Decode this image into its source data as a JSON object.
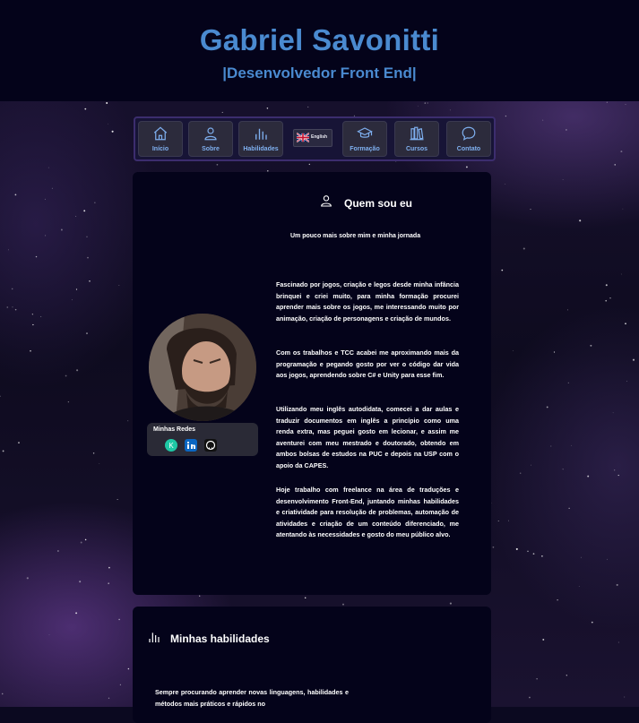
{
  "header": {
    "name": "Gabriel Savonitti",
    "subtitle": "|Desenvolvedor Front End|"
  },
  "nav": {
    "items": [
      {
        "label": "Início",
        "icon": "home-icon"
      },
      {
        "label": "Sobre",
        "icon": "user-icon"
      },
      {
        "label": "Habilidades",
        "icon": "bar-chart-icon"
      },
      {
        "label": "Formação",
        "icon": "graduation-cap-icon"
      },
      {
        "label": "Cursos",
        "icon": "books-icon"
      },
      {
        "label": "Contato",
        "icon": "chat-bubble-icon"
      }
    ],
    "language": {
      "label": "English",
      "icon": "uk-flag-icon"
    }
  },
  "about": {
    "title": "Quem sou eu",
    "subtitle": "Um pouco mais sobre mim e minha jornada",
    "paragraphs": [
      "Fascinado por jogos, criação e legos desde minha infância brinquei e criei muito, para minha formação procurei aprender mais sobre os jogos, me interessando muito por animação, criação de personagens e criação de mundos.",
      "Com os trabalhos e TCC acabei me aproximando mais da programação e pegando gosto por ver o código dar vida aos jogos, aprendendo sobre C# e Unity para esse fim.",
      "Utilizando meu inglês autodidata, comecei a dar aulas e traduzir documentos em inglês a princípio como uma renda extra, mas peguei gosto em lecionar, e assim me aventurei com meu mestrado e doutorado, obtendo em ambos bolsas de estudos na PUC e depois na USP com o apoio da CAPES.",
      "Hoje trabalho com freelance na área de traduções e desenvolvimento Front-End, juntando minhas habilidades e criatividade para resolução de problemas, automação de atividades e criação de um conteúdo diferenciado, me atentando às necessidades e gosto do meu público alvo."
    ],
    "social_title": "Minhas Redes",
    "social": [
      {
        "icon": "kofi-icon",
        "color": "#1ec8a5"
      },
      {
        "icon": "linkedin-icon",
        "color": "#0a66c2"
      },
      {
        "icon": "github-icon",
        "color": "#111111"
      }
    ]
  },
  "skills": {
    "title": "Minhas habilidades",
    "text": "Sempre procurando aprender novas linguagens, habilidades e métodos mais práticos e rápidos no"
  },
  "colors": {
    "accent": "#4a8ad0",
    "nav_label": "#7fb0f0",
    "card_bg": "#04031a"
  }
}
